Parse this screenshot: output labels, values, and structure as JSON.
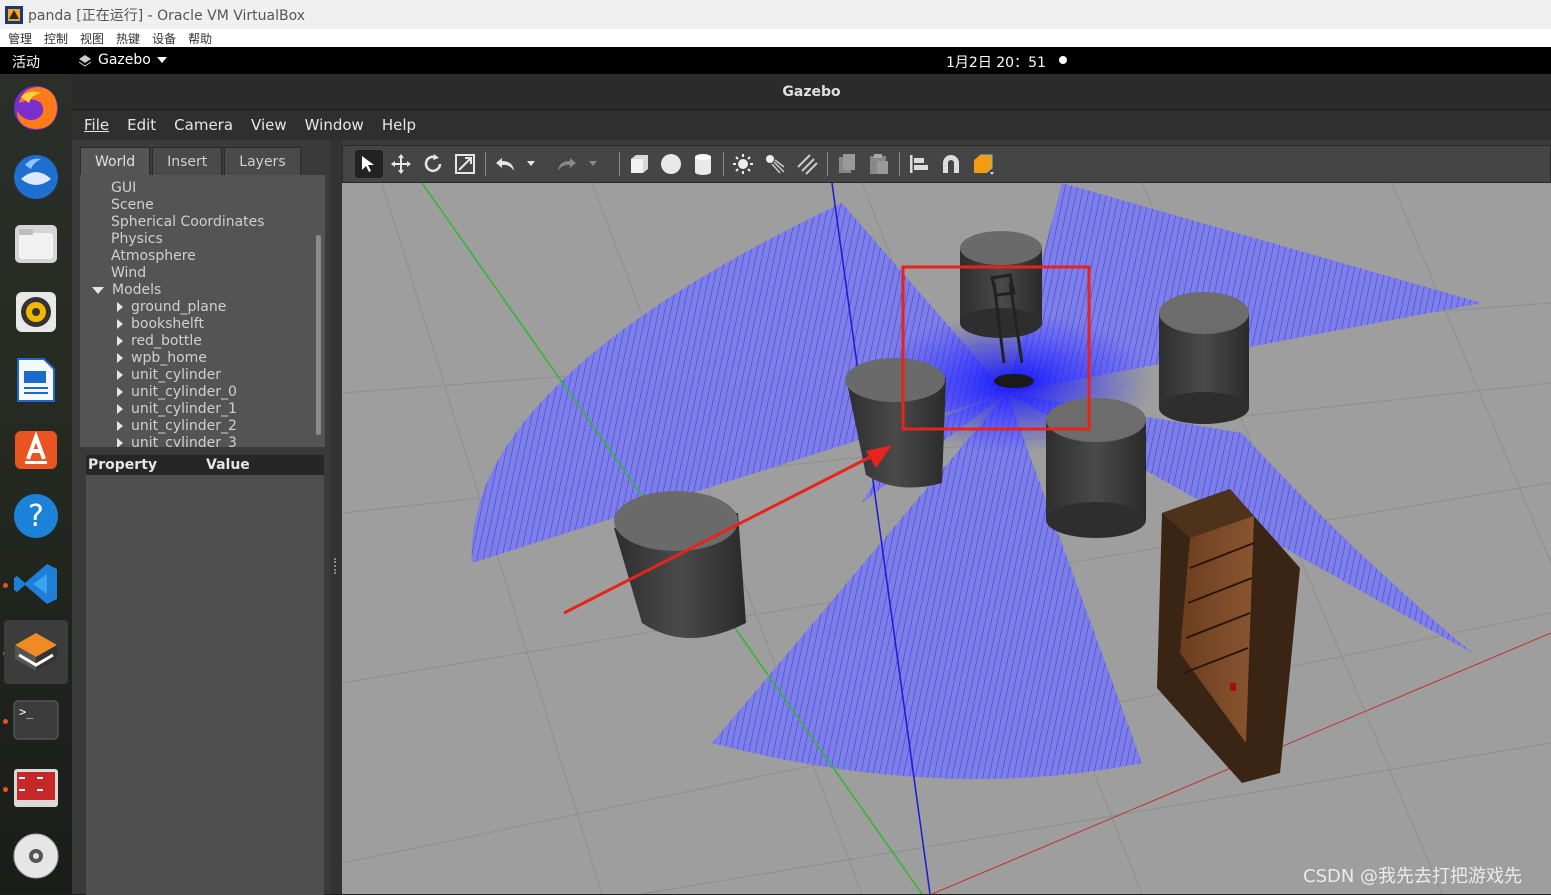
{
  "vbox": {
    "title": "panda [正在运行] - Oracle VM VirtualBox",
    "menu": [
      "管理",
      "控制",
      "视图",
      "热键",
      "设备",
      "帮助"
    ]
  },
  "topbar": {
    "activities": "活动",
    "app_name": "Gazebo",
    "clock": "1月2日  20：51"
  },
  "dock": {
    "items": [
      "firefox-icon",
      "thunderbird-icon",
      "files-icon",
      "rhythmbox-icon",
      "libreoffice-writer-icon",
      "software-center-icon",
      "help-icon",
      "vscode-icon",
      "gazebo-icon",
      "terminal-icon",
      "terminal-red-icon",
      "dvd-icon"
    ]
  },
  "gazebo": {
    "window_title": "Gazebo",
    "menu": [
      "File",
      "Edit",
      "Camera",
      "View",
      "Window",
      "Help"
    ],
    "tabs": [
      "World",
      "Insert",
      "Layers"
    ],
    "tree": {
      "roots": [
        "GUI",
        "Scene",
        "Spherical Coordinates",
        "Physics",
        "Atmosphere",
        "Wind"
      ],
      "models_label": "Models",
      "models": [
        "ground_plane",
        "bookshelft",
        "red_bottle",
        "wpb_home",
        "unit_cylinder",
        "unit_cylinder_0",
        "unit_cylinder_1",
        "unit_cylinder_2",
        "unit_cylinder_3"
      ]
    },
    "property_header": {
      "property": "Property",
      "value": "Value"
    },
    "toolbar_icons": [
      "select-arrow-icon",
      "translate-icon",
      "rotate-icon",
      "scale-icon",
      "undo-icon",
      "undo-dropdown-icon",
      "redo-icon",
      "redo-dropdown-icon",
      "box-shape-icon",
      "sphere-shape-icon",
      "cylinder-shape-icon",
      "point-light-icon",
      "spot-light-icon",
      "directional-light-icon",
      "copy-icon",
      "paste-icon",
      "align-icon",
      "magnet-snap-icon",
      "orange-box-icon"
    ]
  },
  "watermark": "CSDN @我先去打把游戏先",
  "colors": {
    "laser": "#3a3aff",
    "highlight_box": "#e8231c",
    "ground": "#9e9e9e"
  }
}
